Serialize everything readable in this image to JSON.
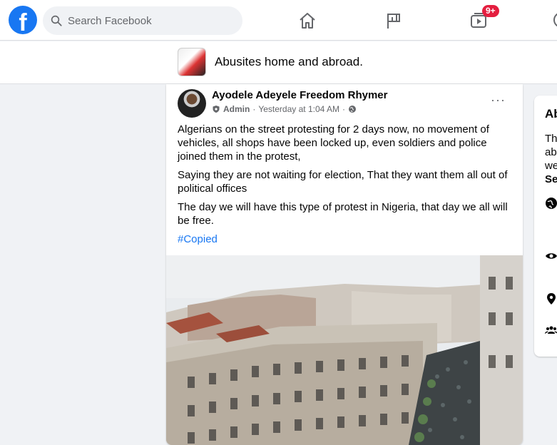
{
  "topnav": {
    "logo": "f",
    "search_placeholder": "Search Facebook",
    "notifications_badge": "9+",
    "icons": [
      "home-icon",
      "pages-flag-icon",
      "watch-video-icon"
    ]
  },
  "group": {
    "name": "Abusites home and abroad."
  },
  "post": {
    "author": "Ayodele Adeyele Freedom Rhymer",
    "role": "Admin",
    "separator": "·",
    "time": "Yesterday at 1:04 AM",
    "paragraphs": [
      "Algerians on the street protesting for 2 days now, no movement of vehicles, all shops have been locked up, even soldiers and police joined them in the protest,",
      "Saying they are not waiting for election, That they want them all out of political offices",
      "The day we will have this type of protest in Nigeria, that day we all will be free."
    ],
    "hashtag": "#Copied",
    "more_label": "···"
  },
  "sidecard": {
    "title": "Ab",
    "desc_lines": [
      "Th",
      "ab",
      "we",
      "Se"
    ]
  },
  "colors": {
    "brand": "#1877f2",
    "badge": "#e41e3f",
    "background": "#f0f2f5"
  }
}
